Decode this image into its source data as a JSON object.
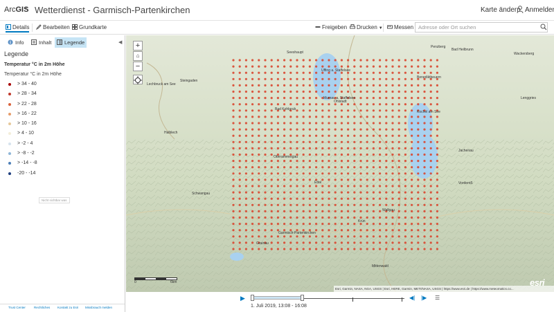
{
  "app": {
    "brand_light": "Arc",
    "brand_bold": "GIS",
    "title": "Wetterdienst - Garmisch-Partenkirchen",
    "change_map": "Karte ändern",
    "sign_in": "Anmelden"
  },
  "toolbar": {
    "details": "Details",
    "edit": "Bearbeiten",
    "basemap": "Grundkarte",
    "share": "Freigeben",
    "print": "Drucken",
    "measure": "Messen",
    "search_placeholder": "Adresse oder Ort suchen"
  },
  "sidebar": {
    "tabs": {
      "info": "Info",
      "content": "Inhalt",
      "legend": "Legende"
    },
    "legend_heading": "Legende",
    "layer_name": "Temperatur °C in 2m Höhe",
    "layer_sub": "Temperatur °C in 2m Höhe",
    "zoom_hint": "Nicht sichtbar was",
    "legend_items": [
      {
        "label": "> 34 - 40",
        "color": "#a80000"
      },
      {
        "label": "> 28 - 34",
        "color": "#c0392b"
      },
      {
        "label": "> 22 - 28",
        "color": "#d9623b"
      },
      {
        "label": "> 16 - 22",
        "color": "#e69c6a"
      },
      {
        "label": "> 10 - 16",
        "color": "#e6c99b"
      },
      {
        "label": "> 4 - 10",
        "color": "#f3eeda"
      },
      {
        "label": "> -2 - 4",
        "color": "#d6e3ee"
      },
      {
        "label": "> -8 - -2",
        "color": "#8fb6d8"
      },
      {
        "label": "> -14 - -8",
        "color": "#4d7fb8"
      },
      {
        "label": "-20 - -14",
        "color": "#1f3f7f"
      }
    ],
    "footer_links": [
      "Trust Center",
      "Rechtliches",
      "Kontakt zu Esri",
      "Missbrauch melden"
    ]
  },
  "map": {
    "places": [
      "Kochel am See",
      "Benediktbeuern",
      "Penzberg",
      "Bad Heilbrunn",
      "Wackersberg",
      "Lenggries",
      "Jachenau",
      "Vorderriß",
      "Murnau a. Staffelsee",
      "Uffing a. Staffelsee",
      "Bad Kohlgrub",
      "Oberammergau",
      "Ettal",
      "Garmisch-Partenkirchen",
      "Grainau",
      "Krün",
      "Wallgau",
      "Mittenwald",
      "Lechbruck am See",
      "Steingaden",
      "Halblech",
      "Schwangau",
      "Seeshaupt",
      "Ohlstadt"
    ],
    "scale_zero": "0",
    "scale_end": "6km",
    "attribution": "Esri, Garmin, NASA, NGA, USGS | Esri, HERE, Garmin, METI/NASA, USGS | https://www.esri.de | https://www.meteomatics.co...",
    "esri_logo": "esri",
    "dot_color": "#d9462f",
    "water_color": "#a9d1ef"
  },
  "timeline": {
    "label": "1. Juli 2019, 13:08 - 16:08"
  }
}
